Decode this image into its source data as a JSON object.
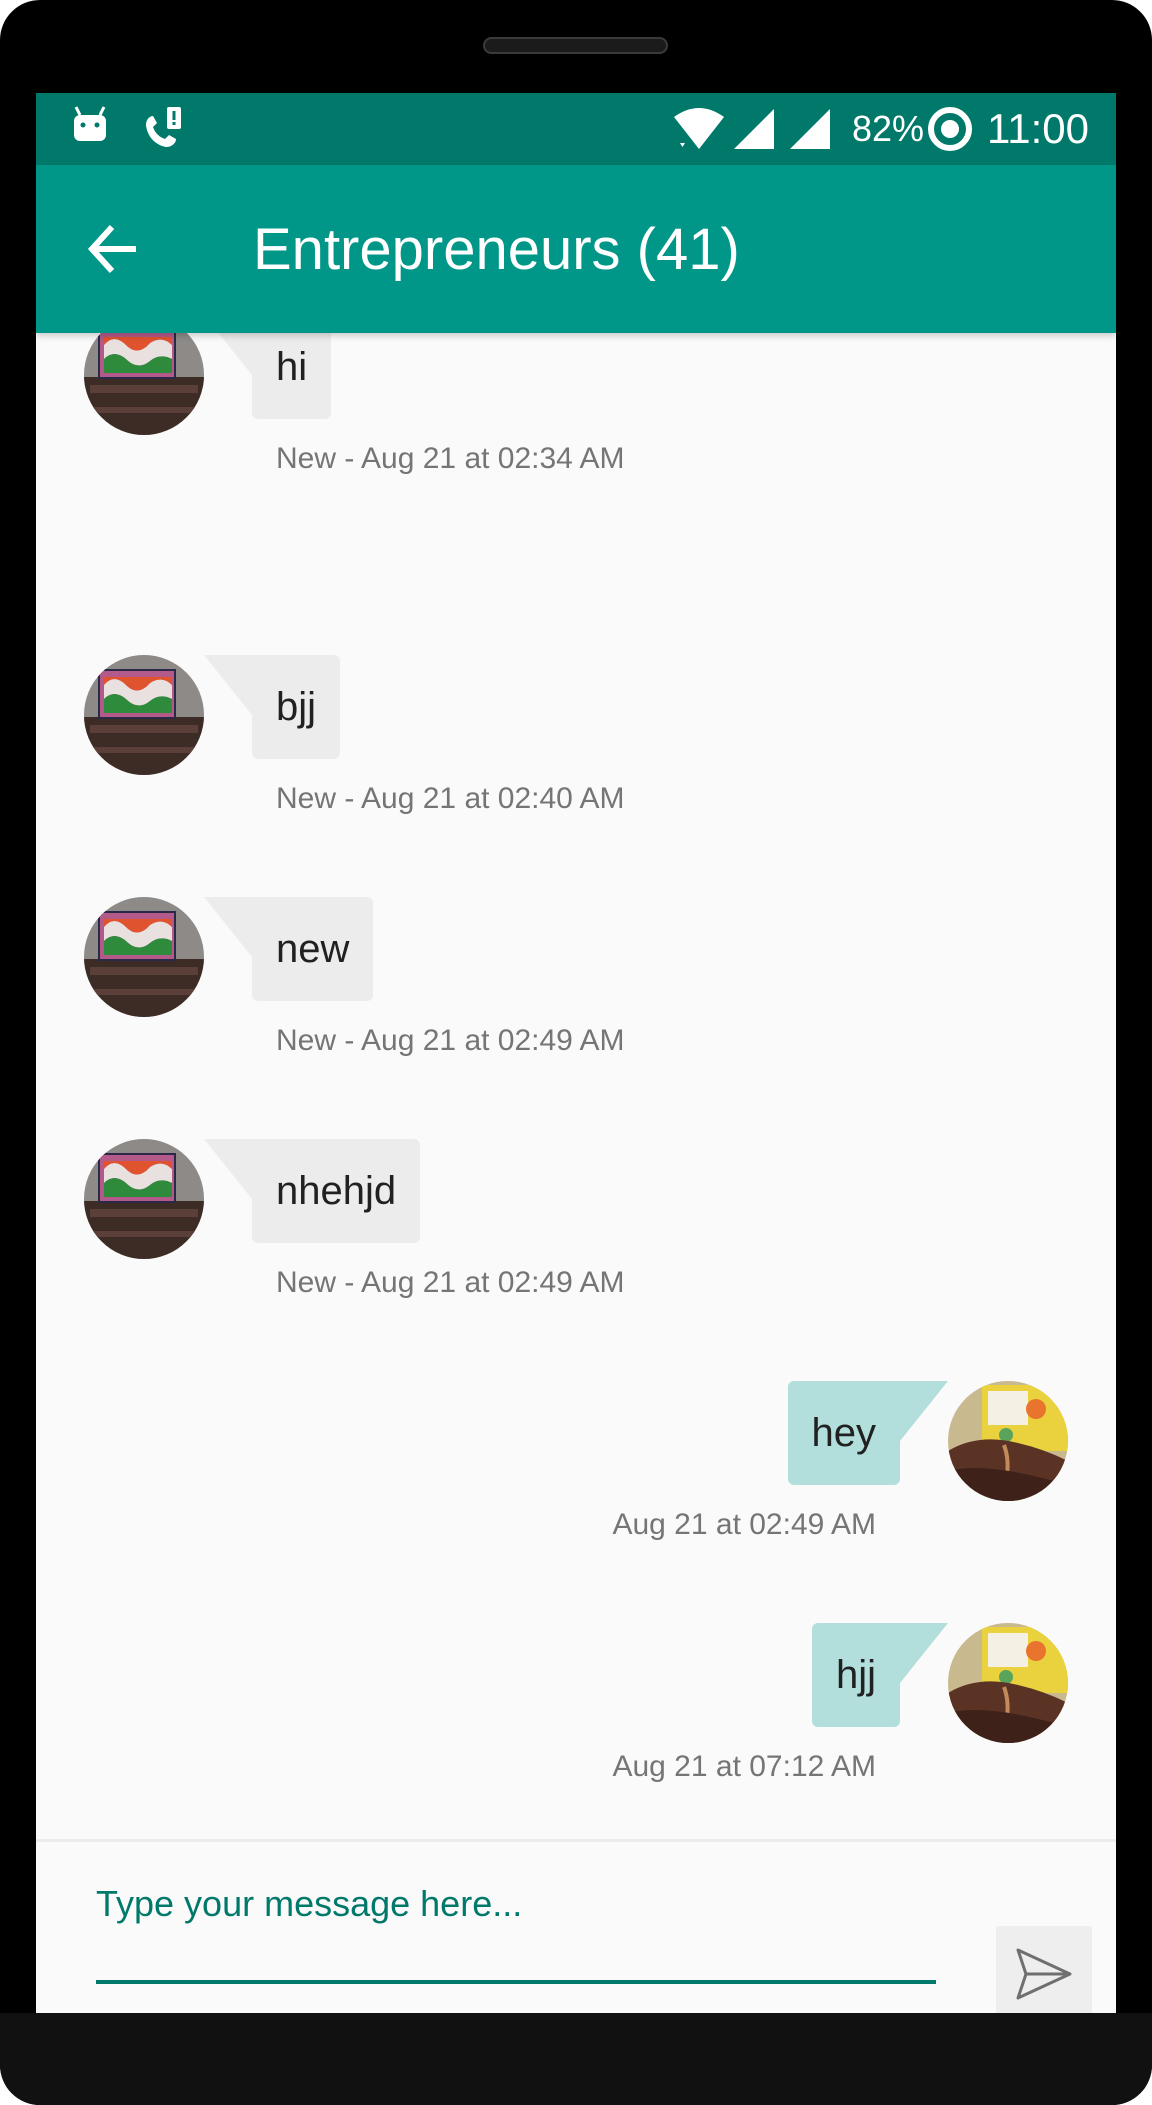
{
  "status_bar": {
    "battery_percent": "82%",
    "time": "11:00",
    "icons": [
      "android-icon",
      "call-alert-icon",
      "wifi-icon",
      "cell-signal-icon",
      "cell-signal-icon",
      "battery-saver-icon"
    ]
  },
  "toolbar": {
    "title": "Entrepreneurs (41)",
    "back_icon": "arrow-left-icon"
  },
  "messages": [
    {
      "direction": "incoming",
      "text": "hi",
      "meta": "New - Aug 21 at 02:34 AM"
    },
    {
      "direction": "incoming",
      "text": "bjj",
      "meta": "New - Aug 21 at 02:40 AM"
    },
    {
      "direction": "incoming",
      "text": "new",
      "meta": "New - Aug 21 at 02:49 AM"
    },
    {
      "direction": "incoming",
      "text": "nhehjd",
      "meta": "New - Aug 21 at 02:49 AM"
    },
    {
      "direction": "outgoing",
      "text": "hey",
      "meta": "Aug 21 at 02:49 AM"
    },
    {
      "direction": "outgoing",
      "text": "hjj",
      "meta": "Aug 21 at 07:12 AM"
    }
  ],
  "composer": {
    "placeholder": "Type your message here...",
    "value": "",
    "send_icon": "send-icon"
  },
  "colors": {
    "status_bar": "#00796b",
    "toolbar": "#009688",
    "incoming_bubble": "#ececec",
    "outgoing_bubble": "#b2dfdb",
    "accent": "#00796b"
  }
}
